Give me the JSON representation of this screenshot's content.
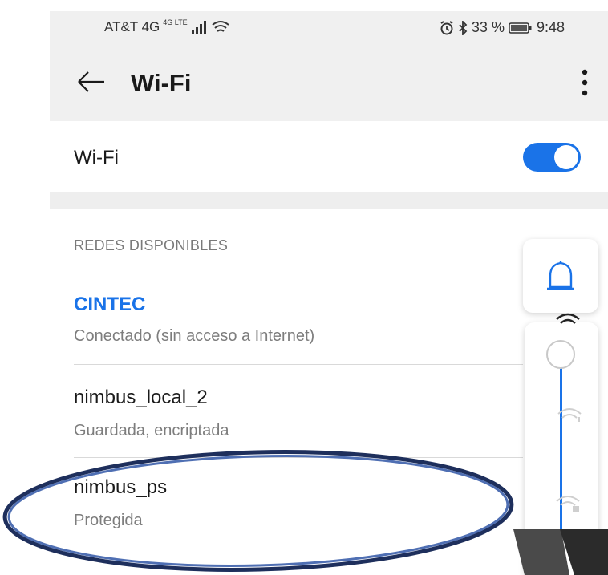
{
  "status_bar": {
    "carrier": "AT&T 4G",
    "network_badge": "4G LTE",
    "battery_percent": "33 %",
    "time": "9:48",
    "icons": [
      "signal-icon",
      "wifi-icon",
      "alarm-icon",
      "bluetooth-icon",
      "battery-icon"
    ]
  },
  "app_bar": {
    "title": "Wi-Fi",
    "back_icon": "arrow-left-icon",
    "menu_icon": "more-vert-icon"
  },
  "wifi_toggle": {
    "label": "Wi-Fi",
    "enabled": true
  },
  "available_networks": {
    "section_title": "REDES DISPONIBLES",
    "items": [
      {
        "name": "CINTEC",
        "status": "Conectado (sin acceso a Internet)",
        "connected": true
      },
      {
        "name": "nimbus_local_2",
        "status": "Guardada, encriptada",
        "connected": false
      },
      {
        "name": "nimbus_ps",
        "status": "Protegida",
        "connected": false
      }
    ]
  },
  "volume_overlay": {
    "icon": "bell-icon",
    "level": 1.0
  },
  "colors": {
    "accent": "#1a73e8",
    "annotation": "#2a4a8c"
  }
}
